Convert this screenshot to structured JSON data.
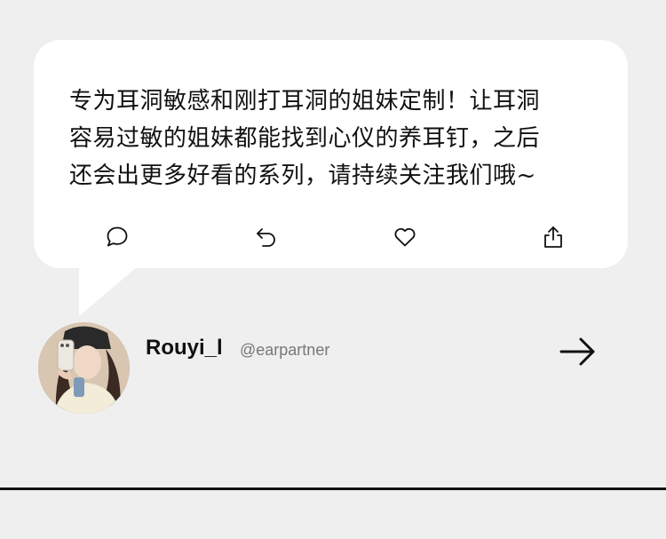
{
  "post": {
    "lines": [
      "专为耳洞敏感和刚打耳洞的姐妹定制！让耳洞",
      "容易过敏的姐妹都能找到心仪的养耳钉，之后",
      "还会出更多好看的系列，请持续关注我们哦~"
    ]
  },
  "actions": [
    {
      "icon": "comment-icon"
    },
    {
      "icon": "repost-icon"
    },
    {
      "icon": "heart-icon"
    },
    {
      "icon": "share-icon"
    }
  ],
  "author": {
    "name": "Rouyi_l",
    "handle": "@earpartner"
  },
  "colors": {
    "background": "#efefef",
    "bubble": "#ffffff",
    "text": "#111111",
    "handle": "#777777"
  }
}
